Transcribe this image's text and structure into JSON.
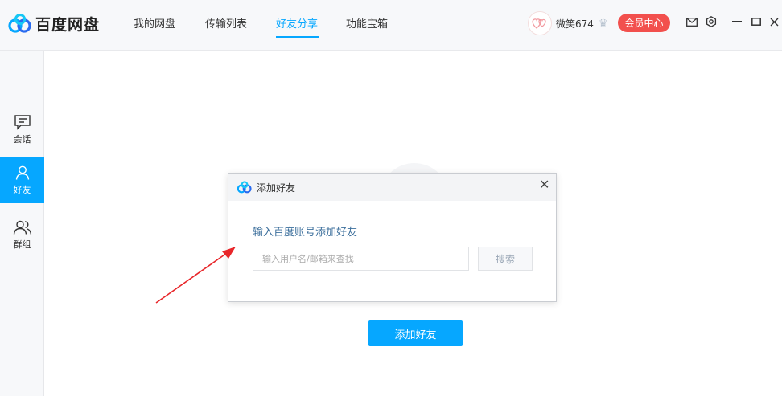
{
  "app": {
    "name": "百度网盘"
  },
  "nav": {
    "items": [
      {
        "label": "我的网盘"
      },
      {
        "label": "传输列表"
      },
      {
        "label": "好友分享"
      },
      {
        "label": "功能宝箱"
      }
    ],
    "active_index": 2
  },
  "user": {
    "name": "微笑674",
    "vip_label": "会员中心"
  },
  "sidebar": {
    "items": [
      {
        "label": "会话"
      },
      {
        "label": "好友"
      },
      {
        "label": "群组"
      }
    ],
    "active_index": 1
  },
  "main": {
    "add_friend_label": "添加好友"
  },
  "dialog": {
    "title": "添加好友",
    "heading": "输入百度账号添加好友",
    "input_placeholder": "输入用户名/邮箱来查找",
    "search_label": "搜索"
  },
  "colors": {
    "accent": "#06a7ff",
    "vip": "#f2504d",
    "annotation": "#e8262a"
  }
}
